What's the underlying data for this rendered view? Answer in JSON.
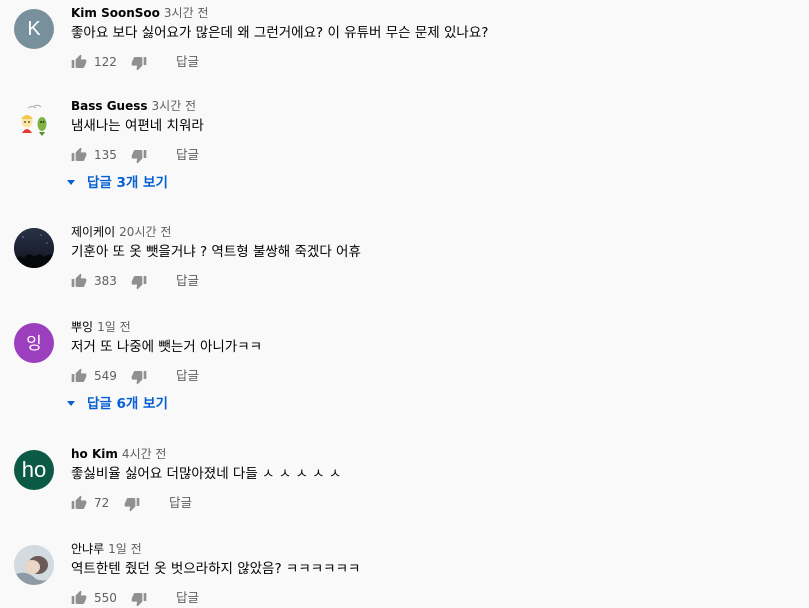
{
  "labels": {
    "reply": "답글"
  },
  "colors": {
    "background": "#f9f9f9",
    "link": "#065fd4",
    "secondary_text": "#606060"
  },
  "comments": [
    {
      "author": "Kim SoonSoo",
      "time": "3시간 전",
      "text": "좋아요 보다 싫어요가 많은데 왜 그런거에요? 이 유튜버 무슨 문제 있나요?",
      "likes": "122",
      "avatar": {
        "type": "letter",
        "letter": "K",
        "color": "#78909c"
      }
    },
    {
      "author": "Bass Guess",
      "time": "3시간 전",
      "text": "냄새나는 여편네 치워라",
      "likes": "135",
      "avatar": {
        "type": "image",
        "icon": "cartoon-characters-icon"
      },
      "view_replies": "답글 3개 보기"
    },
    {
      "author": "제이케이",
      "time": "20시간 전",
      "text": "기훈아 또 옷 뺏을거냐 ? 역트형 불쌍해 죽겠다 어휴",
      "likes": "383",
      "avatar": {
        "type": "image",
        "icon": "night-sky-icon"
      }
    },
    {
      "author": "뿌잉",
      "time": "1일 전",
      "text": "저거 또 나중에 뺏는거 아니가ㅋㅋ",
      "likes": "549",
      "avatar": {
        "type": "letter",
        "letter": "잉",
        "color": "#9c3fbf"
      },
      "view_replies": "답글 6개 보기"
    },
    {
      "author": "ho Kim",
      "time": "4시간 전",
      "text": "좋싫비율 싫어요 더많아졌네 다들 ㅅ ㅅ ㅅ ㅅ ㅅ",
      "likes": "72",
      "avatar": {
        "type": "letter",
        "letter": "ho",
        "color": "#0b5a45"
      }
    },
    {
      "author": "안냐루",
      "time": "1일 전",
      "text": "역트한텐 줬던 옷 벗으라하지 않았음? ㅋㅋㅋㅋㅋㅋ",
      "likes": "550",
      "avatar": {
        "type": "image",
        "icon": "photo-portrait-icon"
      }
    }
  ]
}
